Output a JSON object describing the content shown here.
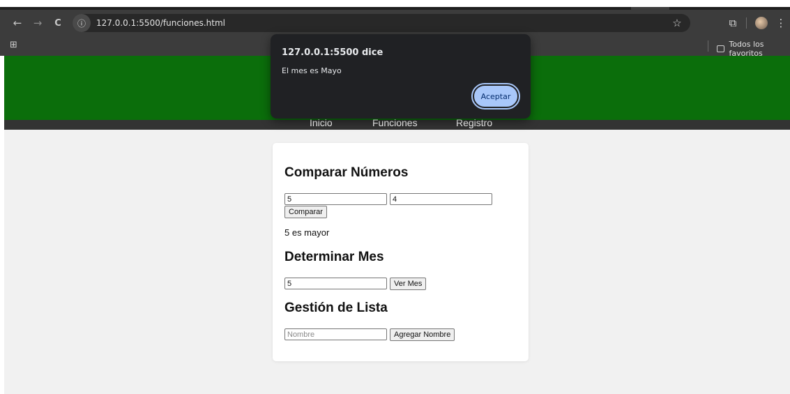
{
  "browser": {
    "url": "127.0.0.1:5500/funciones.html",
    "nav_back": "←",
    "nav_forward": "→",
    "nav_reload": "C",
    "info_icon": "ⓘ",
    "star_icon": "☆",
    "extensions_icon": "⧉",
    "menu_icon": "⋮",
    "apps_icon": "⊞",
    "bookmark_folder": "Todos los favoritos"
  },
  "site": {
    "nav": [
      "Inicio",
      "Funciones",
      "Registro"
    ],
    "header_color": "#0b6e0b"
  },
  "compare": {
    "title": "Comparar Números",
    "input1": "5",
    "input2": "4",
    "button": "Comparar",
    "result": "5 es mayor"
  },
  "month": {
    "title": "Determinar Mes",
    "input": "5",
    "button": "Ver Mes"
  },
  "list": {
    "title": "Gestión de Lista",
    "placeholder": "Nombre",
    "button": "Agregar Nombre"
  },
  "dialog": {
    "title": "127.0.0.1:5500 dice",
    "message": "El mes es Mayo",
    "button": "Aceptar"
  }
}
